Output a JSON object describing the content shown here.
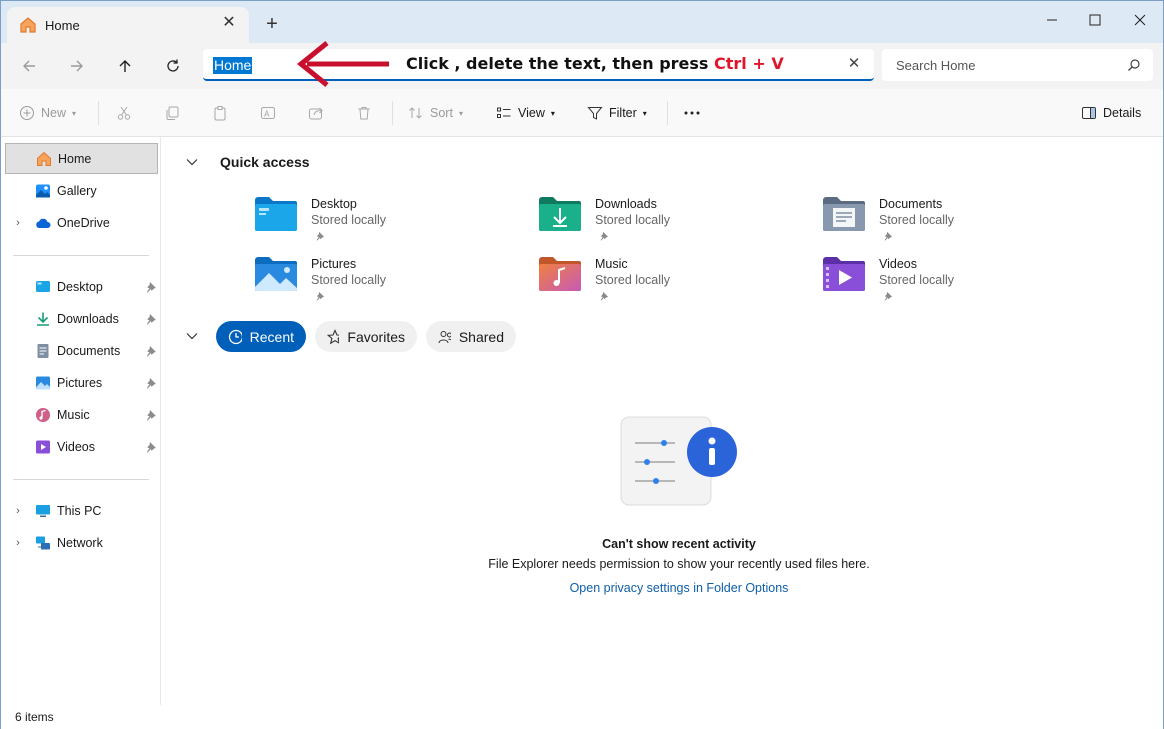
{
  "tab": {
    "title": "Home",
    "close_icon": "close-icon",
    "new_tab_icon": "plus-icon"
  },
  "window_controls": {
    "minimize": "minimize-icon",
    "maximize": "maximize-icon",
    "close": "close-icon"
  },
  "nav": {
    "back": "back-arrow-icon",
    "forward": "forward-arrow-icon",
    "up": "up-arrow-icon",
    "refresh": "refresh-icon",
    "address_value": "Home",
    "search_placeholder": "Search Home"
  },
  "annotation": {
    "text_before": "Click , delete the text, then press ",
    "text_keys": "Ctrl + V",
    "key_color": "#e0162b",
    "arrow_color": "#c8102e"
  },
  "toolbar": {
    "new_label": "New",
    "sort_label": "Sort",
    "view_label": "View",
    "filter_label": "Filter",
    "details_label": "Details"
  },
  "sidebar": {
    "top": [
      {
        "label": "Home",
        "icon": "home-icon",
        "selected": true
      },
      {
        "label": "Gallery",
        "icon": "gallery-icon"
      },
      {
        "label": "OneDrive",
        "icon": "cloud-icon",
        "expandable": true
      }
    ],
    "pinned": [
      {
        "label": "Desktop",
        "icon": "desktop-icon"
      },
      {
        "label": "Downloads",
        "icon": "download-icon"
      },
      {
        "label": "Documents",
        "icon": "documents-icon"
      },
      {
        "label": "Pictures",
        "icon": "pictures-icon"
      },
      {
        "label": "Music",
        "icon": "music-icon"
      },
      {
        "label": "Videos",
        "icon": "videos-icon"
      }
    ],
    "bottom": [
      {
        "label": "This PC",
        "icon": "pc-icon"
      },
      {
        "label": "Network",
        "icon": "network-icon"
      }
    ]
  },
  "quick_access": {
    "title": "Quick access",
    "items": [
      {
        "name": "Desktop",
        "sub": "Stored locally",
        "icon": "desktop-folder-icon"
      },
      {
        "name": "Downloads",
        "sub": "Stored locally",
        "icon": "downloads-folder-icon"
      },
      {
        "name": "Documents",
        "sub": "Stored locally",
        "icon": "documents-folder-icon"
      },
      {
        "name": "Pictures",
        "sub": "Stored locally",
        "icon": "pictures-folder-icon"
      },
      {
        "name": "Music",
        "sub": "Stored locally",
        "icon": "music-folder-icon"
      },
      {
        "name": "Videos",
        "sub": "Stored locally",
        "icon": "videos-folder-icon"
      }
    ]
  },
  "filter_tabs": {
    "recent": "Recent",
    "favorites": "Favorites",
    "shared": "Shared"
  },
  "empty_state": {
    "title": "Can't show recent activity",
    "description": "File Explorer needs permission to show your recently used files here.",
    "link": "Open privacy settings in Folder Options"
  },
  "status": {
    "items_count": "6 items"
  },
  "colors": {
    "accent": "#005fb8",
    "selection": "#0078d4"
  }
}
